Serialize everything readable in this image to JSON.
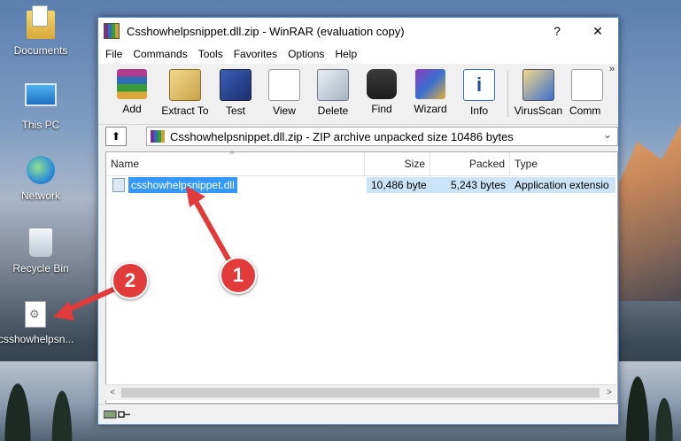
{
  "desktop": {
    "icons": [
      {
        "label": "Documents",
        "icon": "folder-icon"
      },
      {
        "label": "This PC",
        "icon": "computer-icon"
      },
      {
        "label": "Network",
        "icon": "network-icon"
      },
      {
        "label": "Recycle Bin",
        "icon": "recycle-bin-icon"
      },
      {
        "label": "csshowhelpsn...",
        "icon": "dll-file-icon"
      }
    ]
  },
  "window": {
    "title": "Csshowhelpsnippet.dll.zip - WinRAR (evaluation copy)",
    "help_glyph": "?",
    "close_glyph": "✕"
  },
  "menu": [
    "File",
    "Commands",
    "Tools",
    "Favorites",
    "Options",
    "Help"
  ],
  "toolbar": {
    "buttons": [
      {
        "label": "Add",
        "icon": "add-books-icon"
      },
      {
        "label": "Extract To",
        "icon": "extract-to-icon"
      },
      {
        "label": "Test",
        "icon": "test-icon"
      },
      {
        "label": "View",
        "icon": "view-glasses-icon"
      },
      {
        "label": "Delete",
        "icon": "delete-icon"
      },
      {
        "label": "Find",
        "icon": "binoculars-icon"
      },
      {
        "label": "Wizard",
        "icon": "wizard-icon"
      },
      {
        "label": "Info",
        "icon": "info-icon"
      },
      {
        "label": "VirusScan",
        "icon": "virus-scan-icon"
      },
      {
        "label": "Comm",
        "icon": "comment-icon"
      }
    ],
    "overflow_glyph": "»"
  },
  "address": {
    "up_glyph": "⬆",
    "text": "Csshowhelpsnippet.dll.zip - ZIP archive unpacked size 10486 bytes",
    "dropdown_glyph": "⌄"
  },
  "file_list": {
    "columns": [
      "Name",
      "Size",
      "Packed",
      "Type"
    ],
    "sort_glyph": "^",
    "rows": [
      {
        "name": "csshowhelpsnippet.dll",
        "size": "10,486 byte",
        "packed": "5,243 bytes",
        "type": "Application extensio"
      }
    ]
  },
  "scroll": {
    "left": "<",
    "right": ">"
  },
  "annotations": {
    "badge1": "1",
    "badge2": "2",
    "color": "#e23b3b"
  }
}
